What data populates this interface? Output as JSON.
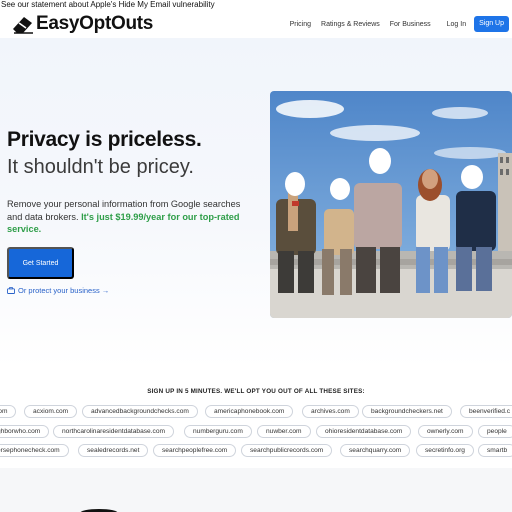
{
  "announcement": "See our statement about Apple's Hide My Email vulnerability",
  "header": {
    "logo_text": "EasyOptOuts",
    "nav": [
      "Pricing",
      "Ratings & Reviews",
      "For Business"
    ],
    "login": "Log In",
    "signup": "Sign Up",
    "accent_color": "#1e74e8"
  },
  "hero": {
    "headline": "Privacy is priceless.",
    "subheadline": "It shouldn't be pricey.",
    "description_prefix": "Remove your personal information from Google searches and data brokers. ",
    "description_price": "It's just $19.99/year for our top-rated service.",
    "cta": "Get Started",
    "business_link": "Or protect your business →",
    "price_color": "#2f9e49"
  },
  "sites": {
    "heading": "SIGN UP IN 5 MINUTES. WE'LL OPT YOU OUT OF ALL THESE SITES:",
    "rows": [
      [
        "com",
        "acxiom.com",
        "advancedbackgroundchecks.com",
        "americaphonebook.com",
        "archives.com",
        "backgroundcheckers.net",
        "beenverified.c"
      ],
      [
        "ghborwho.com",
        "northcarolinaresidentdatabase.com",
        "numberguru.com",
        "nuwber.com",
        "ohioresidentdatabase.com",
        "ownerly.com",
        "people"
      ],
      [
        "ersephonecheck.com",
        "sealedrecords.net",
        "searchpeoplefree.com",
        "searchpublicrecords.com",
        "searchquarry.com",
        "secretinfo.org",
        "smartb"
      ]
    ]
  }
}
